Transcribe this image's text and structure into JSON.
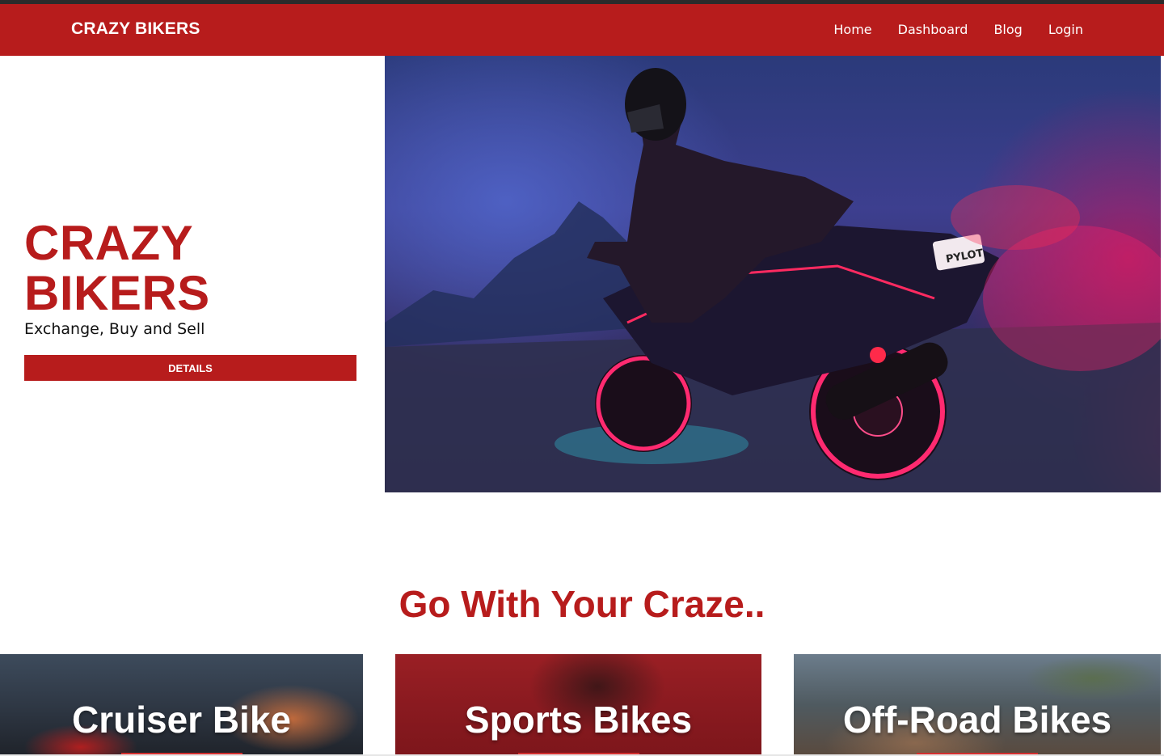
{
  "navbar": {
    "brand": "CRAZY BIKERS",
    "links": [
      "Home",
      "Dashboard",
      "Blog",
      "Login"
    ]
  },
  "hero": {
    "title": "CRAZY BIKERS",
    "subtitle": "Exchange, Buy and Sell",
    "button_label": "DETAILS",
    "image_plate_text": "PYLOT"
  },
  "section": {
    "title": "Go With Your Craze.."
  },
  "cards": [
    {
      "label": "Cruiser Bike"
    },
    {
      "label": "Sports Bikes"
    },
    {
      "label": "Off-Road Bikes"
    }
  ],
  "colors": {
    "brand_red": "#b71c1c",
    "text_dark": "#111111",
    "white": "#ffffff"
  }
}
